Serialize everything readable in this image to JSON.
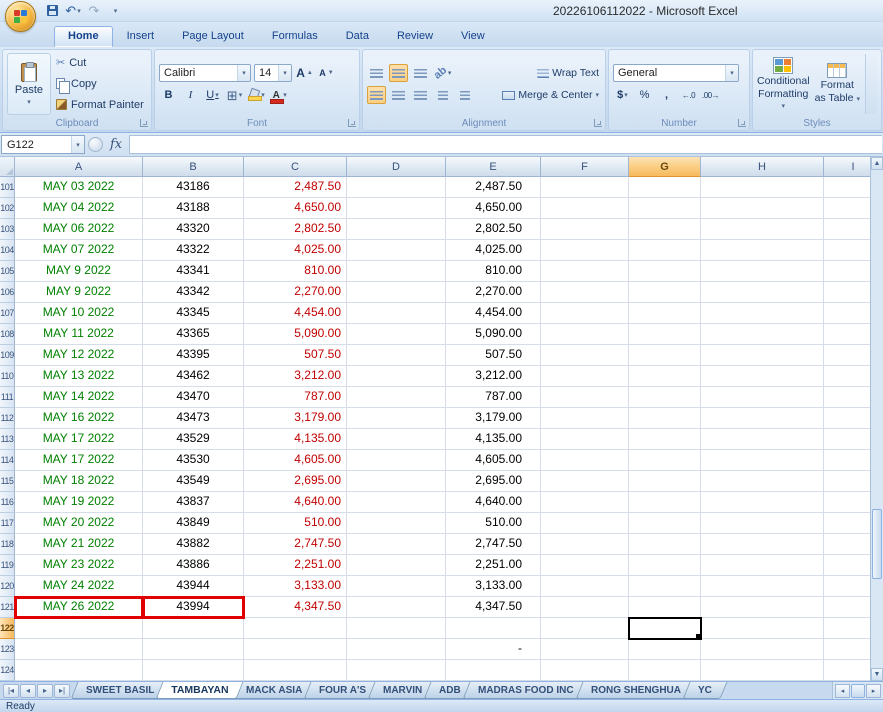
{
  "window": {
    "title": "20226106112022 - Microsoft Excel",
    "status": "Ready"
  },
  "ribbon": {
    "tabs": [
      {
        "label": "Home",
        "active": true
      },
      {
        "label": "Insert",
        "active": false
      },
      {
        "label": "Page Layout",
        "active": false
      },
      {
        "label": "Formulas",
        "active": false
      },
      {
        "label": "Data",
        "active": false
      },
      {
        "label": "Review",
        "active": false
      },
      {
        "label": "View",
        "active": false
      }
    ],
    "clipboard": {
      "group_label": "Clipboard",
      "paste": "Paste",
      "cut": "Cut",
      "copy": "Copy",
      "format_painter": "Format Painter"
    },
    "font": {
      "group_label": "Font",
      "font_name": "Calibri",
      "font_size": "14",
      "bold": "B",
      "italic": "I",
      "underline": "U",
      "grow_letter": "A",
      "shrink_letter": "A",
      "font_color_letter": "A"
    },
    "alignment": {
      "group_label": "Alignment",
      "wrap_text": "Wrap Text",
      "merge_center": "Merge & Center"
    },
    "number": {
      "group_label": "Number",
      "format": "General",
      "currency": "$",
      "percent": "%",
      "comma": ",",
      "inc_decimal": "←.0",
      "dec_decimal": ".00→"
    },
    "styles": {
      "group_label": "Styles",
      "conditional_1": "Conditional",
      "conditional_2": "Formatting",
      "format_table_1": "Format",
      "format_table_2": "as Table"
    }
  },
  "formula_bar": {
    "name_box": "G122",
    "fx": "fx",
    "formula": ""
  },
  "grid": {
    "columns": [
      "A",
      "B",
      "C",
      "D",
      "E",
      "F",
      "G",
      "H",
      "I"
    ],
    "active_cell": "G122",
    "selected_column": "G",
    "selected_row": "122",
    "highlight_cells": [
      "A121",
      "B121"
    ],
    "colors": {
      "date_text": "#008000",
      "amount_text": "#C00000",
      "total_text": "#000000",
      "highlight_border": "#E00000"
    },
    "rows": [
      {
        "n": "101",
        "a": "MAY 03 2022",
        "b": "43186",
        "c": "2,487.50",
        "e": "2,487.50"
      },
      {
        "n": "102",
        "a": "MAY 04 2022",
        "b": "43188",
        "c": "4,650.00",
        "e": "4,650.00"
      },
      {
        "n": "103",
        "a": "MAY 06 2022",
        "b": "43320",
        "c": "2,802.50",
        "e": "2,802.50"
      },
      {
        "n": "104",
        "a": "MAY 07 2022",
        "b": "43322",
        "c": "4,025.00",
        "e": "4,025.00"
      },
      {
        "n": "105",
        "a": "MAY 9 2022",
        "b": "43341",
        "c": "810.00",
        "e": "810.00"
      },
      {
        "n": "106",
        "a": "MAY 9 2022",
        "b": "43342",
        "c": "2,270.00",
        "e": "2,270.00"
      },
      {
        "n": "107",
        "a": "MAY 10 2022",
        "b": "43345",
        "c": "4,454.00",
        "e": "4,454.00"
      },
      {
        "n": "108",
        "a": "MAY 11 2022",
        "b": "43365",
        "c": "5,090.00",
        "e": "5,090.00"
      },
      {
        "n": "109",
        "a": "MAY 12 2022",
        "b": "43395",
        "c": "507.50",
        "e": "507.50"
      },
      {
        "n": "110",
        "a": "MAY 13 2022",
        "b": "43462",
        "c": "3,212.00",
        "e": "3,212.00"
      },
      {
        "n": "111",
        "a": "MAY 14 2022",
        "b": "43470",
        "c": "787.00",
        "e": "787.00"
      },
      {
        "n": "112",
        "a": "MAY 16 2022",
        "b": "43473",
        "c": "3,179.00",
        "e": "3,179.00"
      },
      {
        "n": "113",
        "a": "MAY 17 2022",
        "b": "43529",
        "c": "4,135.00",
        "e": "4,135.00"
      },
      {
        "n": "114",
        "a": "MAY 17 2022",
        "b": "43530",
        "c": "4,605.00",
        "e": "4,605.00"
      },
      {
        "n": "115",
        "a": "MAY 18 2022",
        "b": "43549",
        "c": "2,695.00",
        "e": "2,695.00"
      },
      {
        "n": "116",
        "a": "MAY 19 2022",
        "b": "43837",
        "c": "4,640.00",
        "e": "4,640.00"
      },
      {
        "n": "117",
        "a": "MAY 20 2022",
        "b": "43849",
        "c": "510.00",
        "e": "510.00"
      },
      {
        "n": "118",
        "a": "MAY 21 2022",
        "b": "43882",
        "c": "2,747.50",
        "e": "2,747.50"
      },
      {
        "n": "119",
        "a": "MAY 23 2022",
        "b": "43886",
        "c": "2,251.00",
        "e": "2,251.00"
      },
      {
        "n": "120",
        "a": "MAY 24 2022",
        "b": "43944",
        "c": "3,133.00",
        "e": "3,133.00"
      },
      {
        "n": "121",
        "a": "MAY 26 2022",
        "b": "43994",
        "c": "4,347.50",
        "e": "4,347.50"
      },
      {
        "n": "122"
      },
      {
        "n": "123",
        "e": "-"
      },
      {
        "n": "124"
      }
    ]
  },
  "sheet_tabs": {
    "tabs": [
      {
        "label": "SWEET BASIL",
        "active": false
      },
      {
        "label": "TAMBAYAN",
        "active": true
      },
      {
        "label": "MACK ASIA",
        "active": false
      },
      {
        "label": "FOUR A'S",
        "active": false
      },
      {
        "label": "MARVIN",
        "active": false
      },
      {
        "label": "ADB",
        "active": false
      },
      {
        "label": "MADRAS FOOD INC",
        "active": false
      },
      {
        "label": "RONG SHENGHUA",
        "active": false
      },
      {
        "label": "YC",
        "active": false
      }
    ]
  }
}
